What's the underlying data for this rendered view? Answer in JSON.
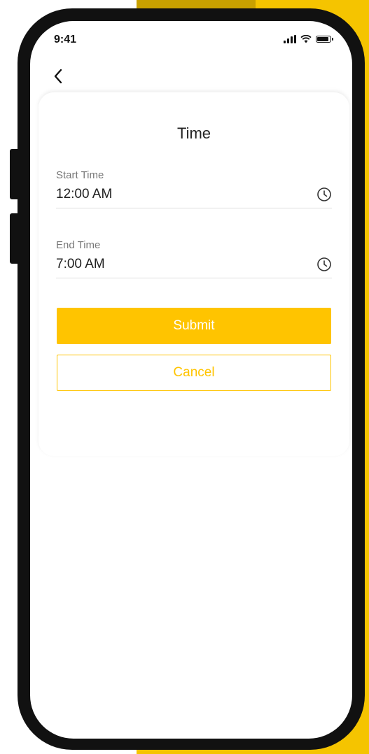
{
  "status_bar": {
    "time": "9:41"
  },
  "card": {
    "title": "Time",
    "start_time": {
      "label": "Start Time",
      "value": "12:00 AM"
    },
    "end_time": {
      "label": "End Time",
      "value": "7:00 AM"
    },
    "submit_label": "Submit",
    "cancel_label": "Cancel"
  },
  "icons": [
    "chevron-left-icon",
    "clock-icon",
    "signal-icon",
    "wifi-icon",
    "battery-icon"
  ],
  "colors": {
    "accent": "#FFC400",
    "backdrop": "#F5C400",
    "phone_frame": "#111111"
  }
}
